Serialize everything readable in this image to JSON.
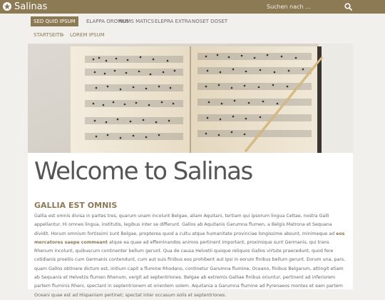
{
  "site": {
    "title": "Salinas"
  },
  "search": {
    "placeholder": "Suchen nach ..."
  },
  "nav": {
    "items": [
      {
        "label": "SED QUID IPSUM",
        "active": true
      },
      {
        "label": "ELAPPA OROMUS",
        "active": false
      },
      {
        "label": "NUMS MATICS",
        "active": false
      },
      {
        "label": "ELEPRA EXTRA",
        "active": false
      },
      {
        "label": "NOSET DOSET",
        "active": false
      }
    ]
  },
  "breadcrumb": {
    "home": "STARTSEITE",
    "separator": "»",
    "current": "LOREM IPSUM"
  },
  "page": {
    "title": "Welcome to Salinas",
    "section_heading": "GALLIA EST OMNIS",
    "paragraph_before": "Gallia est omnis divisa in partes tres, quarum unam incolunt Belgae, aliam Aquitani, tertiam qui ipsorum lingua Celtae, nostra Galli appellantur. Hi omnes lingua, institutis, legibus inter se differunt. Gallos ab Aquitanis Garumna flumen, a Belgis Matrona et Sequana dividit. Horum omnium fortissimi sunt Belgae, propterea quod a cultu atque humanitate provinciae longissime absunt, minimeque ad ",
    "paragraph_highlight": "eos mercatores saepe commeant",
    "paragraph_after": " atque ea quae ad effeminandos animos pertinent important, proximique sunt Germanis, qui trans Rhenum incolunt, quibuscum continenter bellum gerunt. Qua de causa Helvetii quoque reliquos Gallos virtute praecedunt, quod fere cotidianis proeliis cum Germanis contendunt, cum aut suis finibus eos prohibent aut ipsi in eorum finibus bellum gerunt. Eorum una, pars, quam Gallos obtinere dictum est, initium capit a flumine Rhodano, continetur Garumna flumine, Oceano, finibus Belgarum, attingit etiam ab Sequanis et Helvetiis flumen Rhenum, vergit ad septentriones. Belgae ab extremis Galliae finibus oriuntur, pertinent ad inferiorem partem fluminis Rheni, spectant in septentrionem et orientem solem. Aquitania a Garumna flumine ad Pyrenaeos montes et eam partem Oceani quae est ad Hispaniam pertinet; spectat inter occasum solis et septentriones."
  },
  "colors": {
    "accent": "#8c7a55",
    "background": "#f1f0ec",
    "text": "#555555"
  },
  "icons": {
    "logo": "star-circle-icon",
    "search": "search-icon"
  }
}
